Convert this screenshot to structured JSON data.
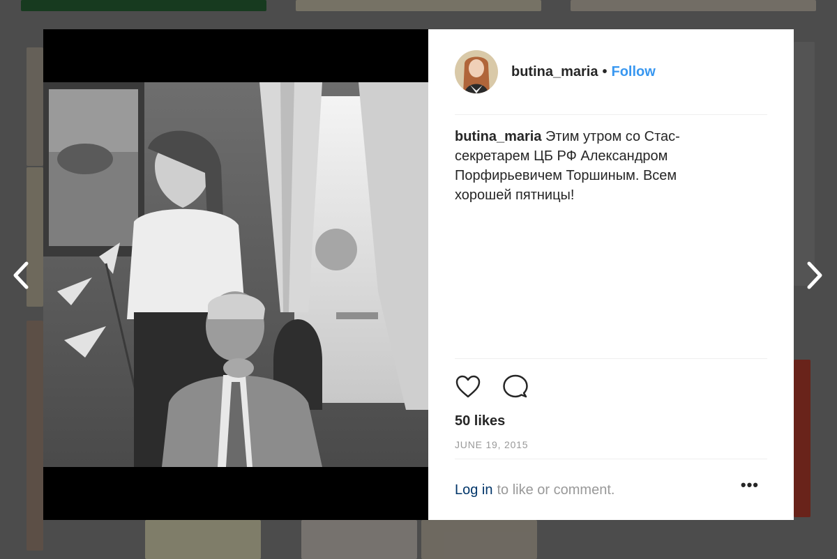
{
  "post": {
    "username": "butina_maria",
    "separator": "•",
    "follow_label": "Follow",
    "caption_user": "butina_maria",
    "caption_text": "Этим утром со Стас-секретарем ЦБ РФ Александром Порфирьевичем Торшиным. Всем хорошей пятницы!",
    "likes": "50 likes",
    "date": "JUNE 19, 2015"
  },
  "comment_bar": {
    "login_label": "Log in",
    "rest_text": "to like or comment."
  },
  "icons": {
    "prev": "chevron-left-icon",
    "next": "chevron-right-icon",
    "like": "heart-icon",
    "comment": "comment-icon",
    "more": "more-options-icon"
  },
  "colors": {
    "follow": "#3897f0",
    "login_link": "#003569",
    "muted_text": "#999999",
    "text": "#262626"
  }
}
